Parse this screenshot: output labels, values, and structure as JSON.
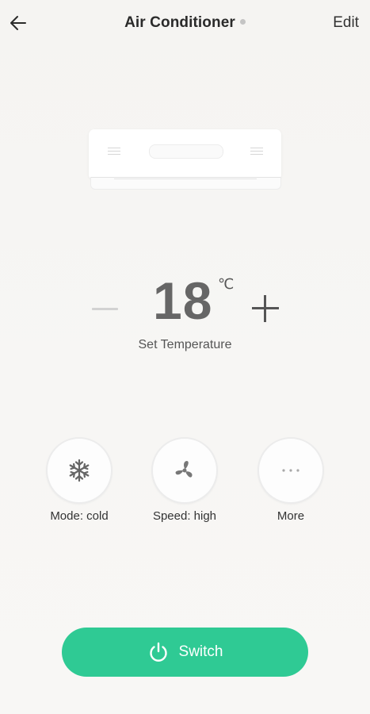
{
  "header": {
    "title": "Air Conditioner",
    "edit_label": "Edit"
  },
  "temperature": {
    "value": "18",
    "unit": "℃",
    "label": "Set Temperature"
  },
  "controls": [
    {
      "label": "Mode: cold",
      "icon": "snowflake-icon"
    },
    {
      "label": "Speed: high",
      "icon": "fan-icon"
    },
    {
      "label": "More",
      "icon": "more-dots-icon"
    }
  ],
  "switch": {
    "label": "Switch",
    "icon": "power-icon"
  },
  "colors": {
    "accent": "#2fca94",
    "background": "#f6f5f3",
    "status_dot": "#c4c4c4"
  }
}
